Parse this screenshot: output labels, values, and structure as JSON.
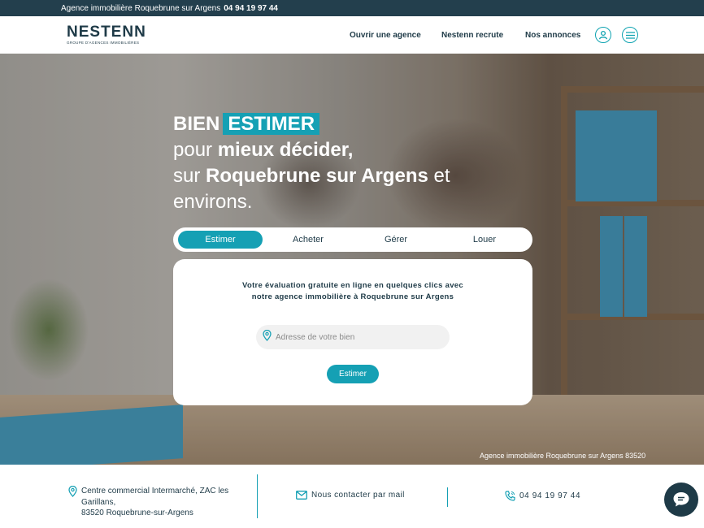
{
  "topbar": {
    "agency_text": "Agence immobilière Roquebrune sur Argens",
    "phone": "04 94 19 97 44"
  },
  "header": {
    "logo_name": "NESTENN",
    "logo_tagline": "GROUPE D'AGENCES IMMOBILIÈRES",
    "nav": [
      {
        "label": "Ouvrir une agence"
      },
      {
        "label": "Nestenn recrute"
      },
      {
        "label": "Nos annonces"
      }
    ],
    "icons": [
      "user-icon",
      "menu-icon"
    ]
  },
  "hero": {
    "headline": {
      "word1": "BIEN",
      "highlight": "ESTIMER",
      "line2_prefix": "pour",
      "line2_bold": "mieux décider,",
      "line3_prefix": "sur",
      "line3_bold": "Roquebrune sur Argens",
      "line3_suffix": "et",
      "line4": "environs."
    },
    "tabs": [
      {
        "label": "Estimer",
        "active": true
      },
      {
        "label": "Acheter",
        "active": false
      },
      {
        "label": "Gérer",
        "active": false
      },
      {
        "label": "Louer",
        "active": false
      }
    ],
    "card": {
      "title": "Votre évaluation gratuite en ligne en quelques clics avec notre agence immobilière à Roquebrune sur Argens",
      "address_placeholder": "Adresse de votre bien",
      "button_label": "Estimer"
    },
    "caption": "Agence immobilière Roquebrune sur Argens 83520"
  },
  "footer": {
    "address_line1": "Centre commercial Intermarché, ZAC les Garillans,",
    "address_line2": "83520 Roquebrune-sur-Argens",
    "mail_label": "Nous contacter par mail",
    "phone": "04 94 19 97 44"
  },
  "colors": {
    "accent": "#15a0b4",
    "dark": "#1e3a47",
    "topbar": "#233f4d"
  }
}
